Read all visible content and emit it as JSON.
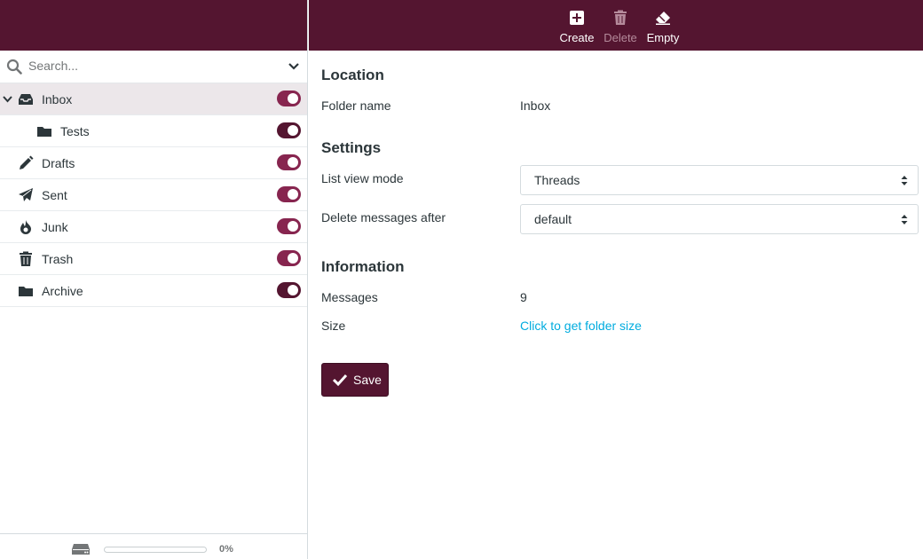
{
  "toolbar": {
    "create_label": "Create",
    "delete_label": "Delete",
    "empty_label": "Empty"
  },
  "search": {
    "placeholder": "Search..."
  },
  "folders": [
    {
      "name": "Inbox",
      "icon": "inbox-icon",
      "subscribed": true,
      "selected": true,
      "expanded": true
    },
    {
      "name": "Tests",
      "icon": "folder-icon",
      "subscribed": true
    },
    {
      "name": "Drafts",
      "icon": "pencil-icon",
      "subscribed": true
    },
    {
      "name": "Sent",
      "icon": "paper-plane-icon",
      "subscribed": true
    },
    {
      "name": "Junk",
      "icon": "fire-icon",
      "subscribed": true
    },
    {
      "name": "Trash",
      "icon": "trash-icon",
      "subscribed": true
    },
    {
      "name": "Archive",
      "icon": "folder-icon",
      "subscribed": true
    }
  ],
  "quota": {
    "percent_label": "0%",
    "percent": 0
  },
  "form": {
    "location_title": "Location",
    "folder_name_label": "Folder name",
    "folder_name_value": "Inbox",
    "settings_title": "Settings",
    "list_view_label": "List view mode",
    "list_view_value": "Threads",
    "delete_after_label": "Delete messages after",
    "delete_after_value": "default",
    "information_title": "Information",
    "messages_label": "Messages",
    "messages_value": "9",
    "size_label": "Size",
    "size_value": "Click to get folder size",
    "save_label": "Save"
  },
  "colors": {
    "brand": "#541530",
    "toggle_on": "#87254f",
    "link": "#00acdf"
  }
}
